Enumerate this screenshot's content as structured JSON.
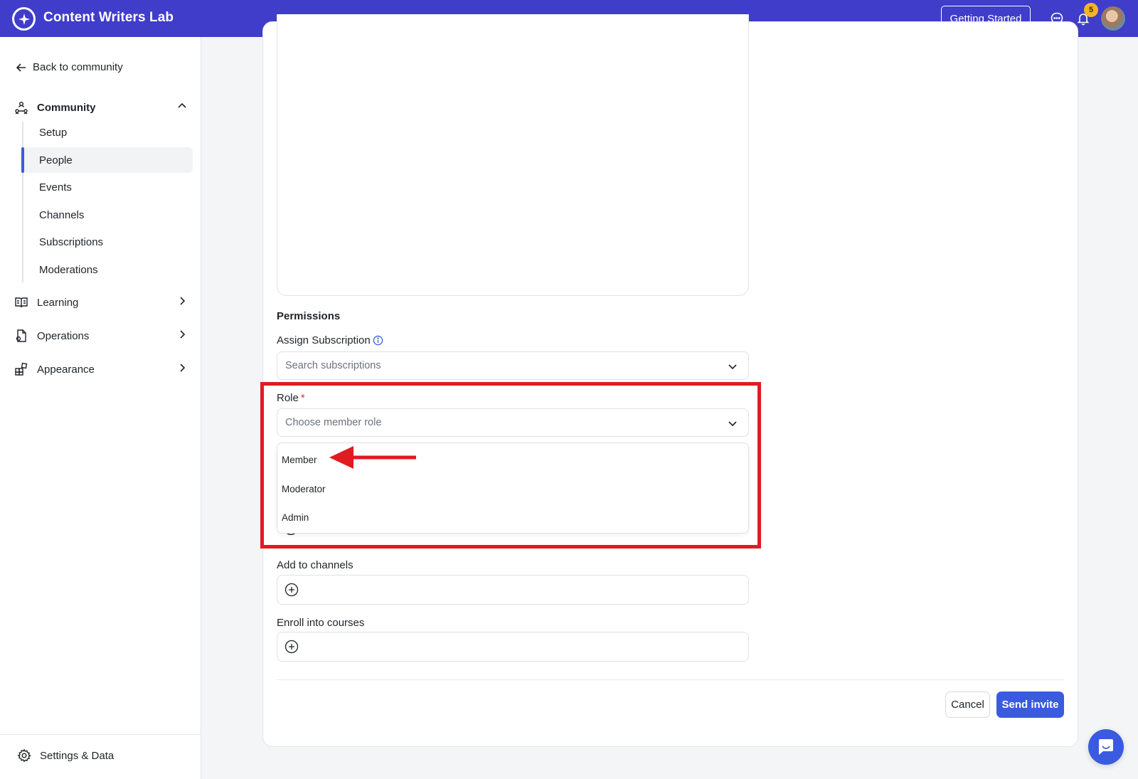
{
  "header": {
    "app_title": "Content Writers Lab",
    "getting_started_label": "Getting Started",
    "notification_count": "5",
    "brand_color": "#3f3dc9",
    "badge_color": "#f5b32a",
    "icons": [
      "logo-sparkle-icon",
      "chat-icon",
      "bell-icon"
    ]
  },
  "sidebar": {
    "back_label": "Back to community",
    "groups": [
      {
        "label": "Community",
        "icon": "community-icon",
        "expanded": true
      },
      {
        "label": "Learning",
        "icon": "book-icon",
        "expanded": false
      },
      {
        "label": "Operations",
        "icon": "operations-icon",
        "expanded": false
      },
      {
        "label": "Appearance",
        "icon": "appearance-icon",
        "expanded": false
      }
    ],
    "community_items": [
      {
        "label": "Setup"
      },
      {
        "label": "People",
        "active": true
      },
      {
        "label": "Events"
      },
      {
        "label": "Channels"
      },
      {
        "label": "Subscriptions"
      },
      {
        "label": "Moderations"
      }
    ],
    "settings_label": "Settings & Data",
    "accent_color": "#3a5be0"
  },
  "form": {
    "permissions_title": "Permissions",
    "subscription_label": "Assign Subscription",
    "subscription_placeholder": "Search subscriptions",
    "role_label": "Role",
    "role_required_mark": "*",
    "role_placeholder": "Choose member role",
    "role_options": [
      "Member",
      "Moderator",
      "Admin"
    ],
    "channels_label": "Add to channels",
    "courses_label": "Enroll into courses",
    "cancel_label": "Cancel",
    "send_label": "Send invite"
  },
  "annotation": {
    "highlight_color": "#e11b22"
  }
}
